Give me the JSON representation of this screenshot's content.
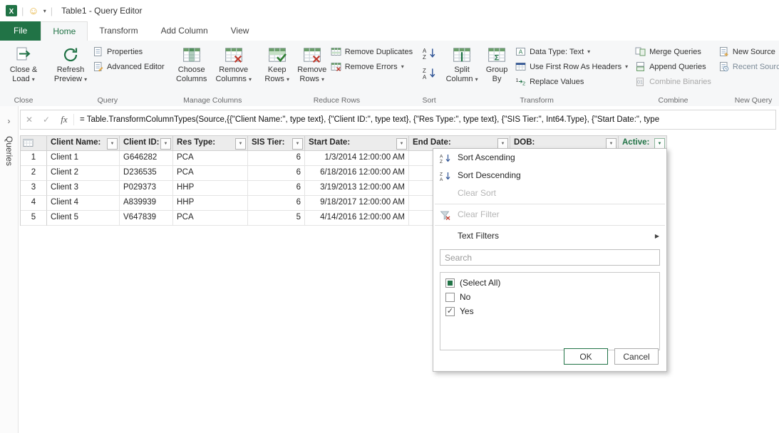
{
  "title_bar": {
    "title": "Table1 - Query Editor"
  },
  "ribbon": {
    "tabs": [
      {
        "label": "File"
      },
      {
        "label": "Home"
      },
      {
        "label": "Transform"
      },
      {
        "label": "Add Column"
      },
      {
        "label": "View"
      }
    ],
    "close_load": {
      "line1": "Close &",
      "line2": "Load"
    },
    "group_close": "Close",
    "refresh": {
      "line1": "Refresh",
      "line2": "Preview"
    },
    "properties": "Properties",
    "advanced_editor": "Advanced Editor",
    "group_query": "Query",
    "choose_columns": {
      "line1": "Choose",
      "line2": "Columns"
    },
    "remove_columns": {
      "line1": "Remove",
      "line2": "Columns"
    },
    "group_manage": "Manage Columns",
    "keep_rows": {
      "line1": "Keep",
      "line2": "Rows"
    },
    "remove_rows": {
      "line1": "Remove",
      "line2": "Rows"
    },
    "remove_duplicates": "Remove Duplicates",
    "remove_errors": "Remove Errors",
    "group_reduce": "Reduce Rows",
    "group_sort": "Sort",
    "split_column": {
      "line1": "Split",
      "line2": "Column"
    },
    "group_by": {
      "line1": "Group",
      "line2": "By"
    },
    "data_type": "Data Type: Text",
    "first_row_headers": "Use First Row As Headers",
    "replace_values": "Replace Values",
    "group_transform": "Transform",
    "merge_queries": "Merge Queries",
    "append_queries": "Append Queries",
    "combine_binaries": "Combine Binaries",
    "group_combine": "Combine",
    "new_source": "New Source",
    "recent_sources": "Recent Sources",
    "group_new_query": "New Query"
  },
  "formula_bar": {
    "fx": "fx",
    "formula": "= Table.TransformColumnTypes(Source,{{\"Client Name:\", type text}, {\"Client ID:\", type text}, {\"Res Type:\", type text}, {\"SIS Tier:\", Int64.Type}, {\"Start Date:\", type"
  },
  "sidebar": {
    "label": "Queries"
  },
  "table": {
    "columns": [
      "Client Name:",
      "Client ID:",
      "Res Type:",
      "SIS Tier:",
      "Start Date:",
      "End Date:",
      "DOB:",
      "Active:"
    ],
    "filtered_column": "Active:",
    "rows": [
      {
        "n": "1",
        "cells": [
          "Client 1",
          "G646282",
          "PCA",
          "6",
          "1/3/2014 12:00:00 AM",
          "",
          "",
          ""
        ]
      },
      {
        "n": "2",
        "cells": [
          "Client 2",
          "D236535",
          "PCA",
          "6",
          "6/18/2016 12:00:00 AM",
          "",
          "",
          ""
        ]
      },
      {
        "n": "3",
        "cells": [
          "Client 3",
          "P029373",
          "HHP",
          "6",
          "3/19/2013 12:00:00 AM",
          "",
          "",
          ""
        ]
      },
      {
        "n": "4",
        "cells": [
          "Client 4",
          "A839939",
          "HHP",
          "6",
          "9/18/2017 12:00:00 AM",
          "",
          "",
          ""
        ]
      },
      {
        "n": "5",
        "cells": [
          "Client 5",
          "V647839",
          "PCA",
          "5",
          "4/14/2016 12:00:00 AM",
          "",
          "",
          ""
        ]
      }
    ]
  },
  "filter_menu": {
    "items": [
      {
        "label": "Sort Ascending",
        "icon": "sort-asc",
        "enabled": true
      },
      {
        "label": "Sort Descending",
        "icon": "sort-desc",
        "enabled": true
      },
      {
        "label": "Clear Sort",
        "enabled": false,
        "separator_after": true
      },
      {
        "label": "Clear Filter",
        "icon": "clear-filter",
        "enabled": false,
        "separator_after": true
      },
      {
        "label": "Text Filters",
        "enabled": true,
        "submenu": true
      }
    ],
    "search_placeholder": "Search",
    "options": [
      {
        "label": "(Select All)",
        "state": "indeterminate"
      },
      {
        "label": "No",
        "state": "unchecked"
      },
      {
        "label": "Yes",
        "state": "checked"
      }
    ],
    "ok_label": "OK",
    "cancel_label": "Cancel"
  },
  "colors": {
    "accent": "#217346"
  }
}
